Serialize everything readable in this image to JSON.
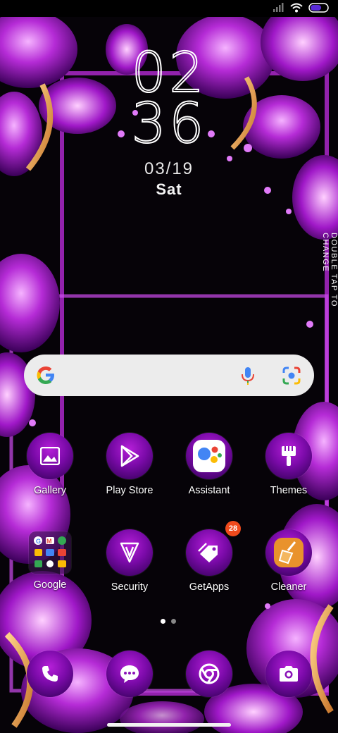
{
  "clock": {
    "hour": "02",
    "minute": "36",
    "date": "03/19",
    "day": "Sat"
  },
  "side_hint": "DOUBLE TAP TO CHANGE",
  "apps": [
    {
      "label": "Gallery"
    },
    {
      "label": "Play Store"
    },
    {
      "label": "Assistant"
    },
    {
      "label": "Themes"
    },
    {
      "label": "Google"
    },
    {
      "label": "Security"
    },
    {
      "label": "GetApps",
      "badge": "28"
    },
    {
      "label": "Cleaner"
    }
  ],
  "dock": [
    {
      "icon": "phone-icon"
    },
    {
      "icon": "messages-icon"
    },
    {
      "icon": "chrome-icon"
    },
    {
      "icon": "camera-icon"
    }
  ],
  "colors": {
    "accent": "#a41ad0",
    "badge": "#f04a1c",
    "search_bg": "#ececec"
  }
}
